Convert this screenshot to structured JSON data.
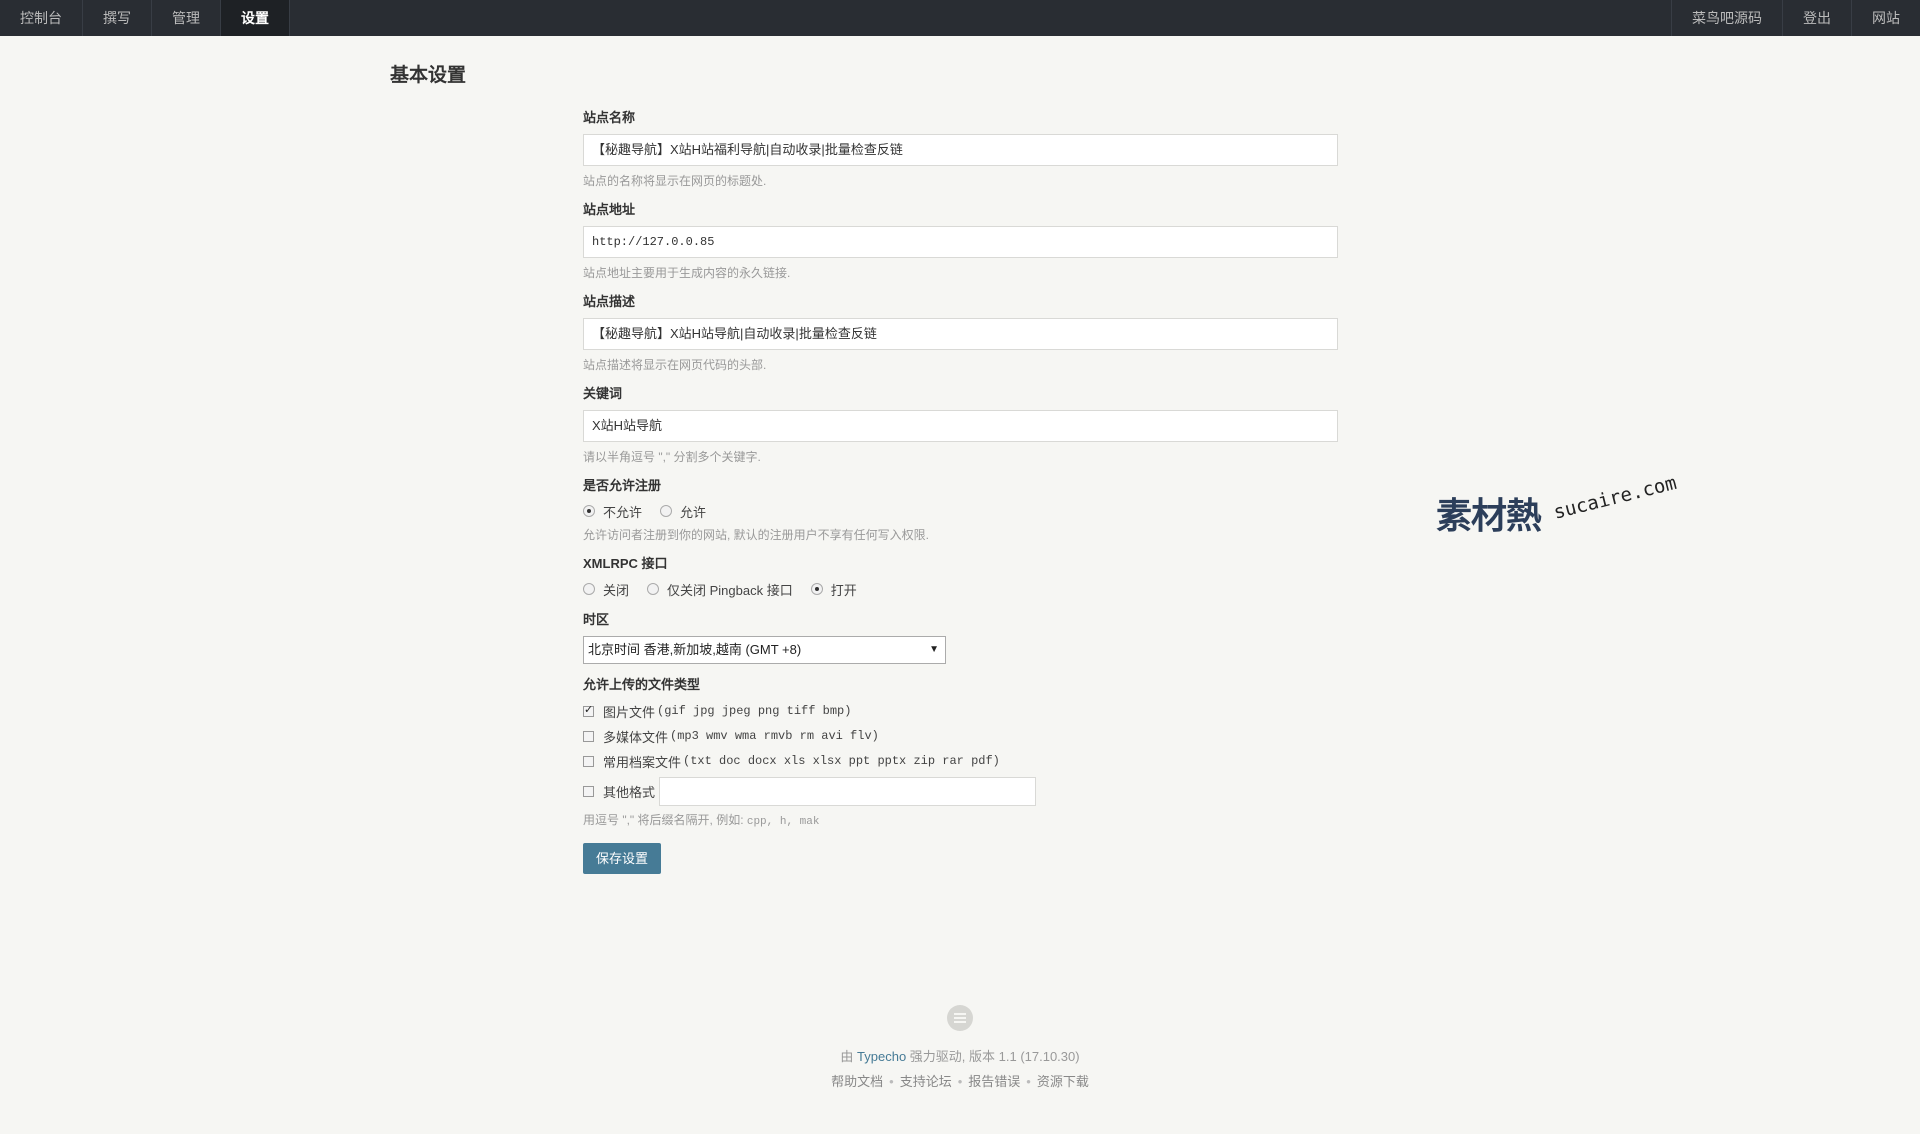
{
  "nav": {
    "left": [
      "控制台",
      "撰写",
      "管理",
      "设置"
    ],
    "active_index": 3,
    "right": [
      "菜鸟吧源码",
      "登出",
      "网站"
    ]
  },
  "page": {
    "title": "基本设置"
  },
  "fields": {
    "site_name": {
      "label": "站点名称",
      "value": "【秘趣导航】X站H站福利导航|自动收录|批量检查反链",
      "desc": "站点的名称将显示在网页的标题处."
    },
    "site_url": {
      "label": "站点地址",
      "value": "http://127.0.0.85",
      "desc": "站点地址主要用于生成内容的永久链接."
    },
    "site_desc": {
      "label": "站点描述",
      "value": "【秘趣导航】X站H站导航|自动收录|批量检查反链",
      "desc": "站点描述将显示在网页代码的头部."
    },
    "keywords": {
      "label": "关键词",
      "value": "X站H站导航",
      "desc": "请以半角逗号 \",\" 分割多个关键字."
    },
    "register": {
      "label": "是否允许注册",
      "options": [
        "不允许",
        "允许"
      ],
      "selected": 0,
      "desc": "允许访问者注册到你的网站, 默认的注册用户不享有任何写入权限."
    },
    "xmlrpc": {
      "label": "XMLRPC 接口",
      "options": [
        "关闭",
        "仅关闭 Pingback 接口",
        "打开"
      ],
      "selected": 2
    },
    "timezone": {
      "label": "时区",
      "value": "北京时间 香港,新加坡,越南 (GMT +8)"
    },
    "upload": {
      "label": "允许上传的文件类型",
      "items": [
        {
          "label": "图片文件",
          "ext": "(gif jpg jpeg png tiff bmp)",
          "checked": true
        },
        {
          "label": "多媒体文件",
          "ext": "(mp3 wmv wma rmvb rm avi flv)",
          "checked": false
        },
        {
          "label": "常用档案文件",
          "ext": "(txt doc docx xls xlsx ppt pptx zip rar pdf)",
          "checked": false
        }
      ],
      "other_label": "其他格式",
      "other_value": "",
      "desc_prefix": "用逗号 \",\" 将后缀名隔开, 例如: ",
      "desc_code": "cpp, h, mak"
    }
  },
  "save_label": "保存设置",
  "watermark": {
    "logo": "素材熱",
    "text": "sucaire.com"
  },
  "footer": {
    "line1_prefix": "由 ",
    "line1_link": "Typecho",
    "line1_suffix": " 强力驱动, 版本 1.1 (17.10.30)",
    "links": [
      "帮助文档",
      "支持论坛",
      "报告错误",
      "资源下载"
    ],
    "separator": "•"
  }
}
